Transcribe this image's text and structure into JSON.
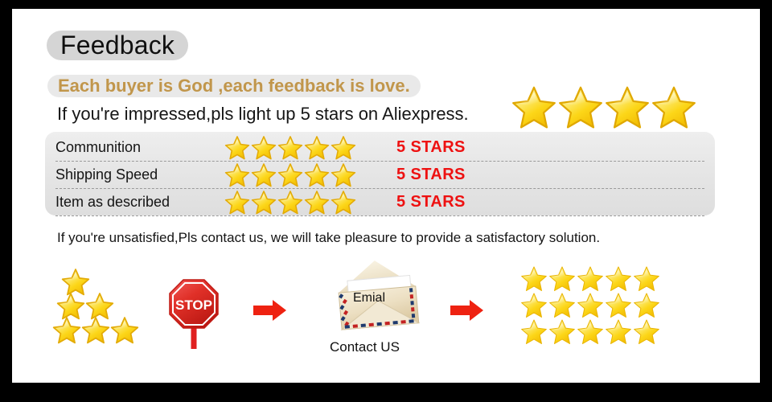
{
  "page": {
    "title": "Feedback",
    "tagline": "Each buyer is God ,each feedback is love.",
    "impressed_line": "If you're impressed,pls light up 5 stars on Aliexpress.",
    "unsatisfied_line": "If you're unsatisfied,Pls contact us, we will take pleasure to provide a satisfactory solution."
  },
  "colors": {
    "frame": "#000000",
    "canvas": "#ffffff",
    "title_pill_bg": "#d5d5d5",
    "tagline_text": "#c1964b",
    "tagline_pill_bg": "#e9e9e9",
    "panel_bg": "#e6e6e6",
    "value_red": "#ee1111",
    "arrow_red": "#ee2211",
    "star_gold": "#fdd835",
    "star_gold_dark": "#e8a90c",
    "stop_red": "#d9201c"
  },
  "hero_stars": {
    "count": 4,
    "icon": "star-icon"
  },
  "ratings": {
    "rows": [
      {
        "label": "Communition",
        "stars": 5,
        "value": "5 STARS"
      },
      {
        "label": "Shipping Speed",
        "stars": 5,
        "value": "5 STARS"
      },
      {
        "label": "Item as described",
        "stars": 5,
        "value": "5 STARS"
      }
    ]
  },
  "flow": {
    "star_pyramid": {
      "rows": [
        1,
        2,
        3
      ],
      "icon": "star-icon"
    },
    "stop_sign": {
      "label": "STOP",
      "icon": "stop-sign-icon"
    },
    "arrow_1": {
      "icon": "arrow-right-icon"
    },
    "arrow_2": {
      "icon": "arrow-right-icon"
    },
    "envelope": {
      "icon": "envelope-icon",
      "letter_text": "Emial",
      "caption": "Contact US"
    },
    "star_grid": {
      "columns": 5,
      "rows": 3,
      "total": 15,
      "icon": "star-icon"
    }
  }
}
